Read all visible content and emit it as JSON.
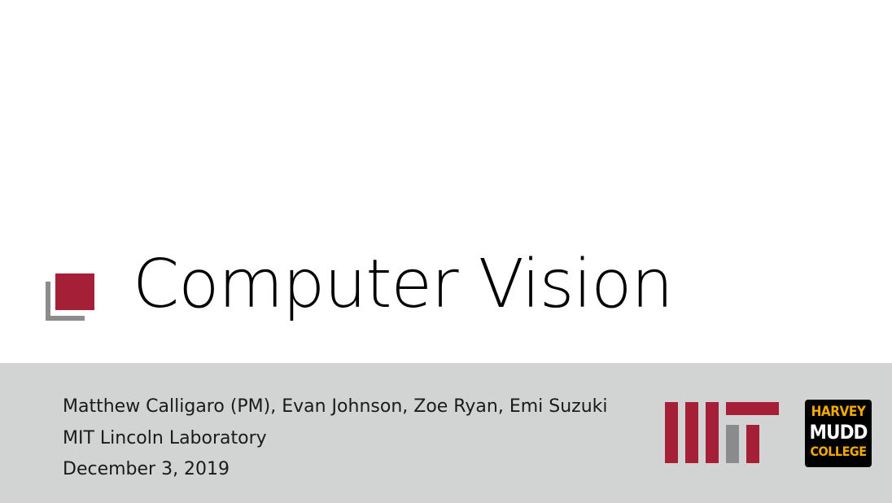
{
  "slide": {
    "title": "Computer Vision",
    "byline": {
      "authors": "Matthew Calligaro (PM), Evan Johnson, Zoe Ryan, Emi Suzuki",
      "organization": "MIT Lincoln Laboratory",
      "date": "December 3, 2019"
    },
    "logos": {
      "mit": {
        "text": "MIT",
        "colors": {
          "primary": "#a51f37",
          "secondary": "#8a8b8c"
        }
      },
      "harvey_mudd": {
        "line1": "HARVEY",
        "line2": "MUDD",
        "line3": "COLLEGE",
        "colors": {
          "background": "#000000",
          "gold": "#f2a900",
          "white": "#ffffff"
        }
      }
    },
    "colors": {
      "accent": "#a51f37",
      "accent_shadow": "#8c8c8c",
      "footer_background": "#d2d4d3",
      "text": "#1a1a1a"
    }
  }
}
